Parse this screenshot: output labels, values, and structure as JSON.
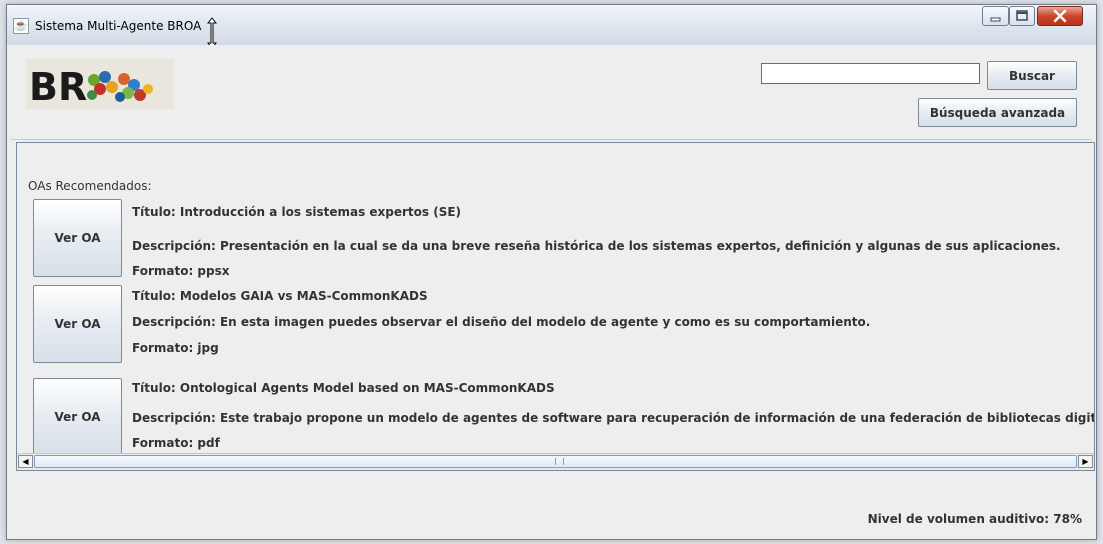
{
  "window": {
    "title": "Sistema Multi-Agente BROA",
    "icon": "java-cup-icon"
  },
  "header": {
    "logo_text": "BROA",
    "search": {
      "value": "",
      "placeholder": ""
    },
    "search_button": "Buscar",
    "advanced_button": "Búsqueda avanzada"
  },
  "recommended": {
    "label": "OAs Recomendados:",
    "items": [
      {
        "button": "Ver OA",
        "title": "Título: Introducción a los sistemas expertos (SE)",
        "description": "Descripción: Presentación en la cual se da una breve reseña histórica de los sistemas expertos, definición y algunas de sus aplicaciones.",
        "format": "Formato: ppsx"
      },
      {
        "button": "Ver OA",
        "title": "Título: Modelos GAIA vs MAS-CommonKADS",
        "description": "Descripción: En esta imagen puedes observar el diseño del modelo de agente y como es su comportamiento.",
        "format": "Formato: jpg"
      },
      {
        "button": "Ver OA",
        "title": "Título:  Ontological Agents Model based on MAS-CommonKADS",
        "description": "Descripción: Este trabajo propone un modelo de agentes de software para recuperación de información de una federación de bibliotecas digitales.",
        "format": "Formato: pdf"
      }
    ]
  },
  "status": {
    "volume": "Nivel de volumen auditivo: 78%"
  },
  "colors": {
    "title_bar": "#dde5ee",
    "button_gradient_bottom": "#d7dfe8",
    "close_button": "#c9462d",
    "logo_dark": "#1a1a1a"
  }
}
